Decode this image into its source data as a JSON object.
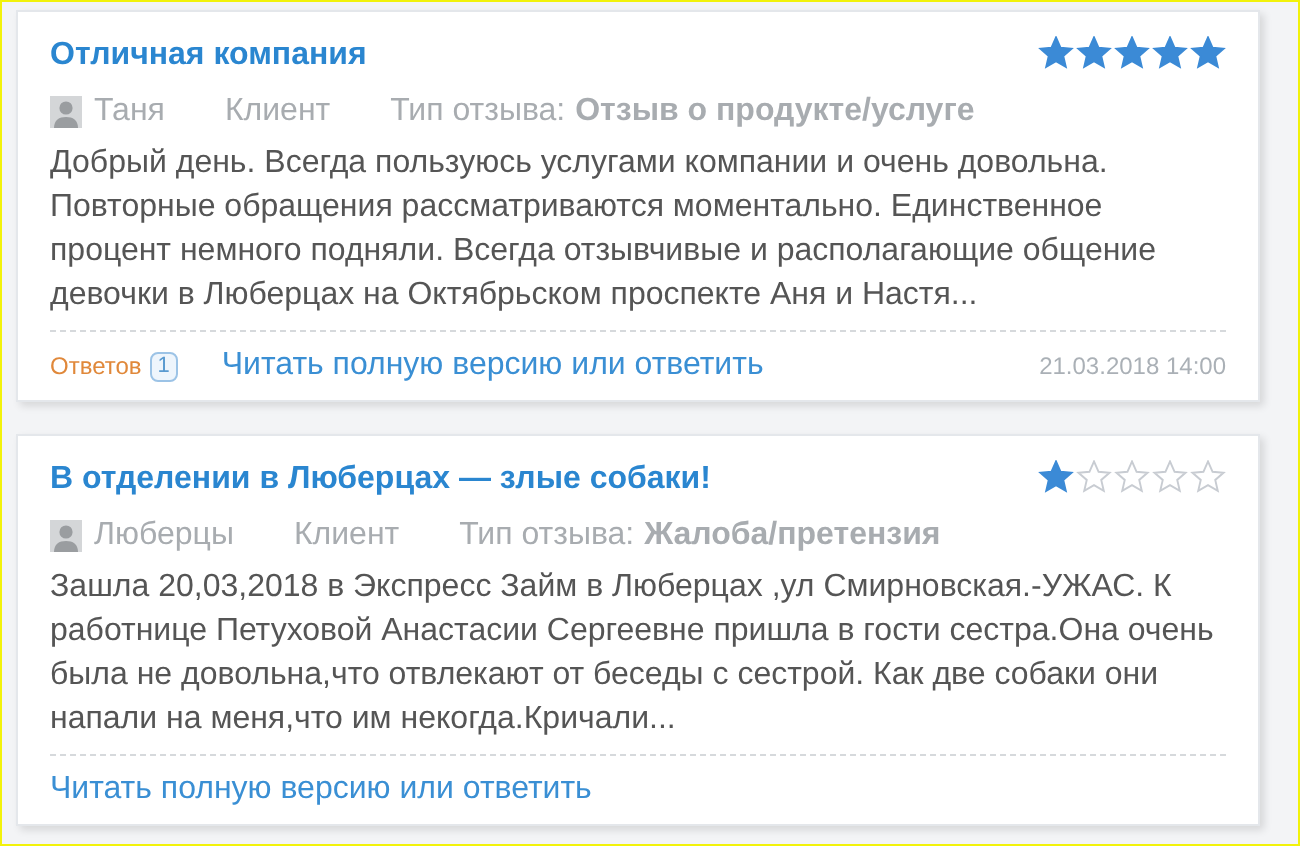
{
  "reviews": [
    {
      "title": "Отличная компания",
      "stars": 5,
      "author": "Таня",
      "role": "Клиент",
      "type_label": "Тип отзыва:",
      "type_value": "Отзыв о продукте/услуге",
      "text": "Добрый день. Всегда пользуюсь услугами компании и очень довольна. Повторные обращения рассматриваются моментально. Единственное процент немного подняли. Всегда отзывчивые и располагающие общение девочки в Люберцах на Октябрьском проспекте Аня и Настя...",
      "replies_label": "Ответов",
      "replies_count": "1",
      "link": "Читать полную версию или ответить",
      "date": "21.03.2018 14:00"
    },
    {
      "title": "В отделении в Люберцах — злые собаки!",
      "stars": 1,
      "author": "Люберцы",
      "role": "Клиент",
      "type_label": "Тип отзыва:",
      "type_value": "Жалоба/претензия",
      "text": "Зашла 20,03,2018 в Экспресс Займ в Люберцах ,ул Смирновская.-УЖАС. К работнице Петуховой Анастасии Сергеевне пришла в гости сестра.Она очень была не довольна,что отвлекают от беседы с сестрой. Как две собаки они напали на меня,что им некогда.Кричали...",
      "link": "Читать полную версию или ответить"
    }
  ]
}
